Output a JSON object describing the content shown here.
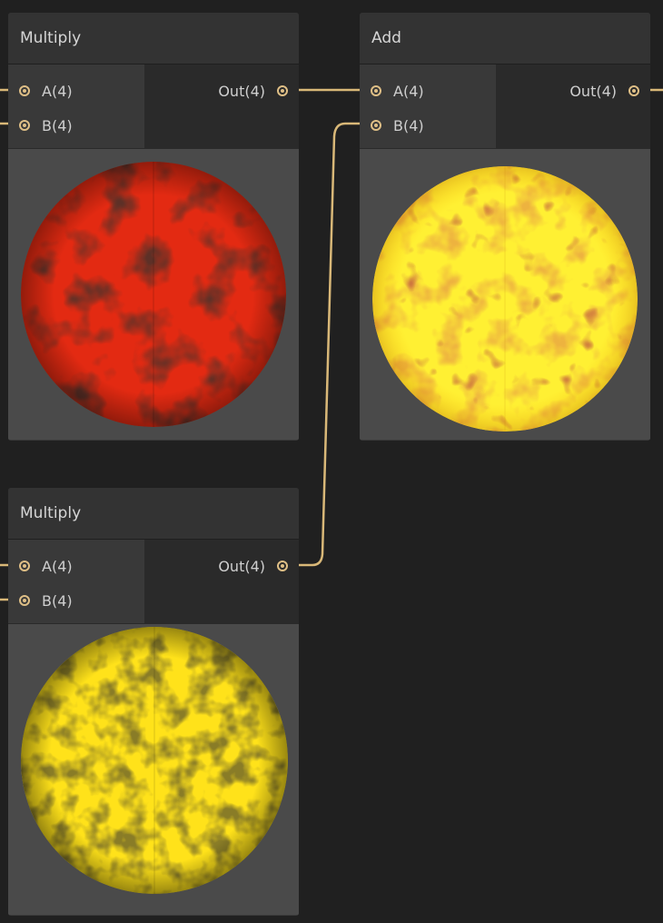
{
  "colors": {
    "background": "#202020",
    "wire": "#d9b878",
    "port": "#dfbf86",
    "node_body": "#393939",
    "preview_bg": "#4a4a4a"
  },
  "nodes": [
    {
      "title": "Multiply",
      "inputs": [
        "A(4)",
        "B(4)"
      ],
      "output": "Out(4)",
      "preview": "red-noise-sphere"
    },
    {
      "title": "Add",
      "inputs": [
        "A(4)",
        "B(4)"
      ],
      "output": "Out(4)",
      "preview": "bright-yellow-noise-sphere"
    },
    {
      "title": "Multiply",
      "inputs": [
        "A(4)",
        "B(4)"
      ],
      "output": "Out(4)",
      "preview": "yellow-dark-noise-sphere"
    }
  ]
}
